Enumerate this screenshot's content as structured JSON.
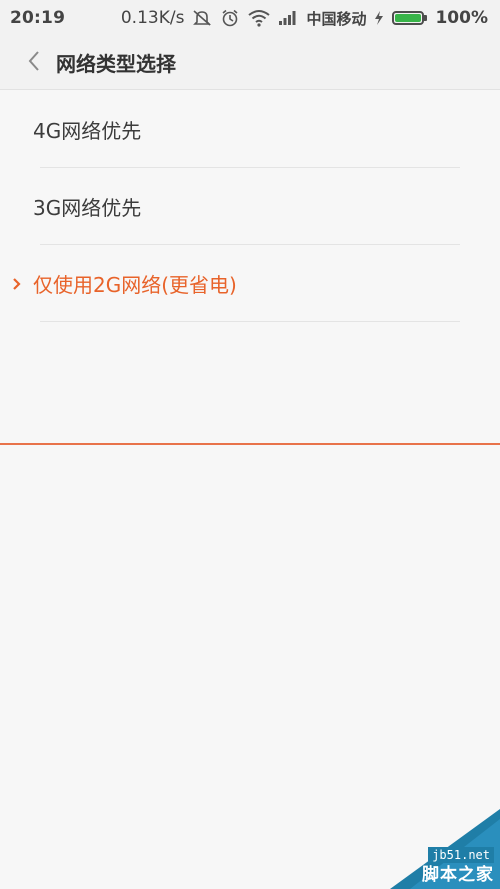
{
  "status_bar": {
    "time": "20:19",
    "network_speed": "0.13K/s",
    "carrier": "中国移动",
    "battery_percent": "100%",
    "battery_level": 1.0,
    "icons": [
      "mute-vibrate-icon",
      "alarm-icon",
      "wifi-icon",
      "signal-icon",
      "charging-icon",
      "battery-icon"
    ]
  },
  "header": {
    "title": "网络类型选择",
    "back_icon": "chevron-left-icon"
  },
  "options": [
    {
      "label": "4G网络优先",
      "selected": false
    },
    {
      "label": "3G网络优先",
      "selected": false
    },
    {
      "label": "仅使用2G网络(更省电)",
      "selected": true
    }
  ],
  "colors": {
    "accent": "#e8632a",
    "background": "#f7f7f7",
    "battery_green": "#38b449"
  },
  "watermark": {
    "site": "jb51.net",
    "name": "脚本之家"
  }
}
